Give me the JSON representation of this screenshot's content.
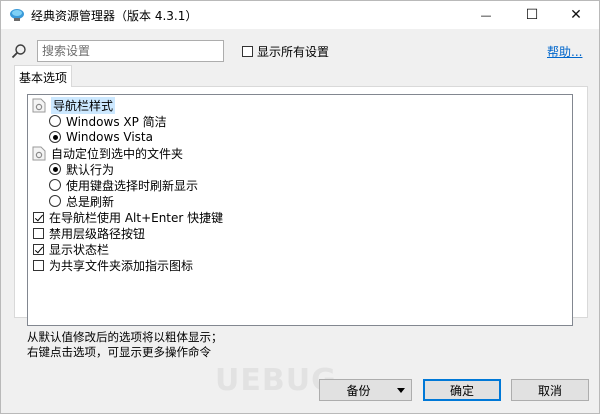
{
  "window": {
    "title": "经典资源管理器（版本 4.3.1）",
    "minimize_glyph": "—",
    "maximize_glyph": "☐",
    "close_glyph": "✕"
  },
  "search": {
    "placeholder": "搜索设置",
    "value": ""
  },
  "show_all": {
    "label": "显示所有设置",
    "checked": false
  },
  "help_label": "帮助...",
  "tabs": [
    {
      "label": "基本选项",
      "active": true
    }
  ],
  "tree": [
    {
      "type": "group",
      "label": "导航栏样式",
      "selected": true
    },
    {
      "type": "radio",
      "label": "Windows XP 简洁",
      "checked": false
    },
    {
      "type": "radio",
      "label": "Windows Vista",
      "checked": true
    },
    {
      "type": "group",
      "label": "自动定位到选中的文件夹",
      "selected": false
    },
    {
      "type": "radio",
      "label": "默认行为",
      "checked": true
    },
    {
      "type": "radio",
      "label": "使用键盘选择时刷新显示",
      "checked": false
    },
    {
      "type": "radio",
      "label": "总是刷新",
      "checked": false
    },
    {
      "type": "checkbox",
      "label": "在导航栏使用 Alt+Enter 快捷键",
      "checked": true
    },
    {
      "type": "checkbox",
      "label": "禁用层级路径按钮",
      "checked": false
    },
    {
      "type": "checkbox",
      "label": "显示状态栏",
      "checked": true
    },
    {
      "type": "checkbox",
      "label": "为共享文件夹添加指示图标",
      "checked": false
    }
  ],
  "description": {
    "line1": "从默认值修改后的选项将以粗体显示；",
    "line2": "右键点击选项，可显示更多操作命令"
  },
  "buttons": {
    "backup": "备份",
    "ok": "确定",
    "cancel": "取消"
  },
  "watermark": "UEBUG",
  "colors": {
    "selection": "#cce8ff",
    "link": "#0066cc",
    "primary_border": "#0078d7"
  }
}
